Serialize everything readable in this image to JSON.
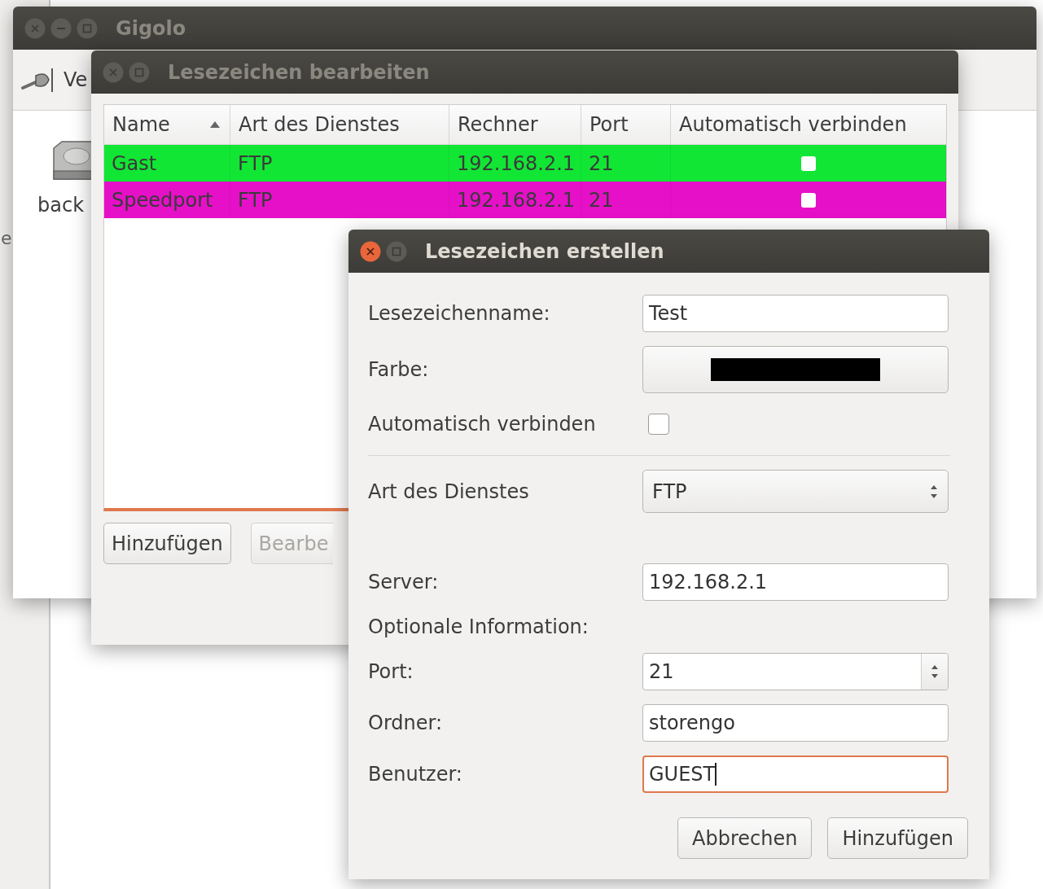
{
  "background_window": {
    "text": "e"
  },
  "main_window": {
    "title": "Gigolo",
    "active": false,
    "title_buttons": [
      {
        "kind": "close"
      },
      {
        "kind": "minimize"
      },
      {
        "kind": "maximize"
      }
    ],
    "toolbar": [
      {
        "label": "Ve"
      }
    ],
    "bookmarks": [
      {
        "label": "back"
      }
    ]
  },
  "edit_dialog": {
    "title": "Lesezeichen bearbeiten",
    "active": false,
    "title_buttons": [
      {
        "kind": "close"
      },
      {
        "kind": "maximize"
      }
    ],
    "table": {
      "columns": [
        {
          "label": "Name",
          "sorted": true
        },
        {
          "label": "Art des Dienstes",
          "sorted": false
        },
        {
          "label": "Rechner",
          "sorted": false
        },
        {
          "label": "Port",
          "sorted": false
        },
        {
          "label": "Automatisch verbinden",
          "sorted": false
        }
      ],
      "rows": [
        {
          "name": "Gast",
          "service": "FTP",
          "host": "192.168.2.1",
          "port": "21",
          "auto_connect": false,
          "color": "#12e634"
        },
        {
          "name": "Speedport",
          "service": "FTP",
          "host": "192.168.2.1",
          "port": "21",
          "auto_connect": false,
          "color": "#e610c8"
        }
      ]
    },
    "buttons": [
      {
        "label": "Hinzufügen",
        "disabled": false
      },
      {
        "label": "Bearbe",
        "disabled": true
      }
    ]
  },
  "create_dialog": {
    "title": "Lesezeichen erstellen",
    "active": true,
    "title_buttons": [
      {
        "kind": "close"
      },
      {
        "kind": "maximize"
      }
    ],
    "fields": [
      {
        "kind": "entry",
        "label": "Lesezeichenname:",
        "value": "Test",
        "focused": false
      },
      {
        "kind": "color",
        "label": "Farbe:",
        "color": "#000000"
      },
      {
        "kind": "checkbox",
        "label": "Automatisch verbinden",
        "checked": false
      },
      {
        "kind": "separator"
      },
      {
        "kind": "combo",
        "label": "Art des Dienstes",
        "value": "FTP"
      },
      {
        "kind": "spacer"
      },
      {
        "kind": "entry",
        "label": "Server:",
        "value": "192.168.2.1",
        "focused": false
      },
      {
        "kind": "heading",
        "label": "Optionale Information:"
      },
      {
        "kind": "spin",
        "label": "Port:",
        "value": "21"
      },
      {
        "kind": "entry",
        "label": "Ordner:",
        "value": "storengo",
        "focused": false
      },
      {
        "kind": "entry",
        "label": "Benutzer:",
        "value": "GUEST",
        "focused": true
      }
    ],
    "buttons": [
      {
        "label": "Abbrechen"
      },
      {
        "label": "Hinzufügen"
      }
    ]
  }
}
